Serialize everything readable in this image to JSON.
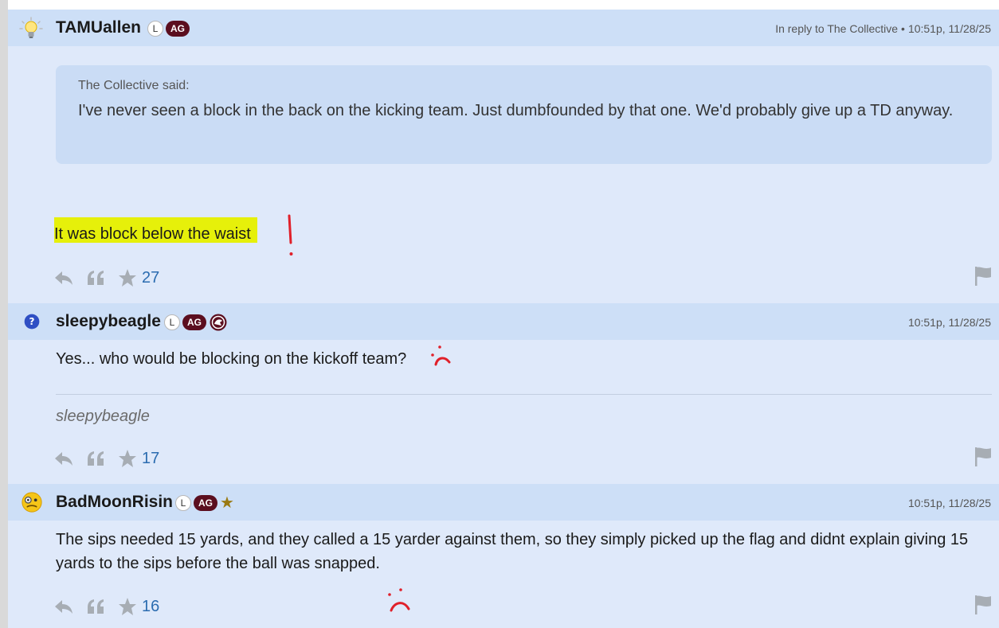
{
  "posts": [
    {
      "username": "TAMUallen",
      "badge_l": "L",
      "badge_ag": "AG",
      "meta_reply": "In reply to The Collective",
      "meta_sep": "•",
      "meta_time": "10:51p, 11/28/25",
      "quote_author": "The Collective said:",
      "quote_text": "I've never seen a block in the back on the kicking team. Just dumbfounded by that one. We'd probably give up a TD anyway.",
      "body": "It was block below the waist",
      "stars": "27",
      "avatar_icon": "lightbulb-icon"
    },
    {
      "username": "sleepybeagle",
      "badge_l": "L",
      "badge_ag": "AG",
      "meta_time": "10:51p, 11/28/25",
      "body": "Yes... who would be blocking on the kickoff team?",
      "signature": "sleepybeagle",
      "stars": "17",
      "avatar_icon": "question-icon"
    },
    {
      "username": "BadMoonRisin",
      "badge_l": "L",
      "badge_ag": "AG",
      "badge_star": "★",
      "meta_time": "10:51p, 11/28/25",
      "body": "The sips needed 15 yards, and they called a 15 yarder against them, so they simply picked up the flag and didnt explain giving 15 yards to the sips before the ball was snapped.",
      "stars": "16",
      "avatar_icon": "detective-emoji-icon"
    }
  ],
  "colors": {
    "header_bg": "#cddff7",
    "post_bg": "#dfe9fa",
    "ag_badge": "#5b0e1f",
    "highlight": "#e6f00a",
    "annotation_red": "#e0202a",
    "star_count": "#2b6cb0"
  }
}
